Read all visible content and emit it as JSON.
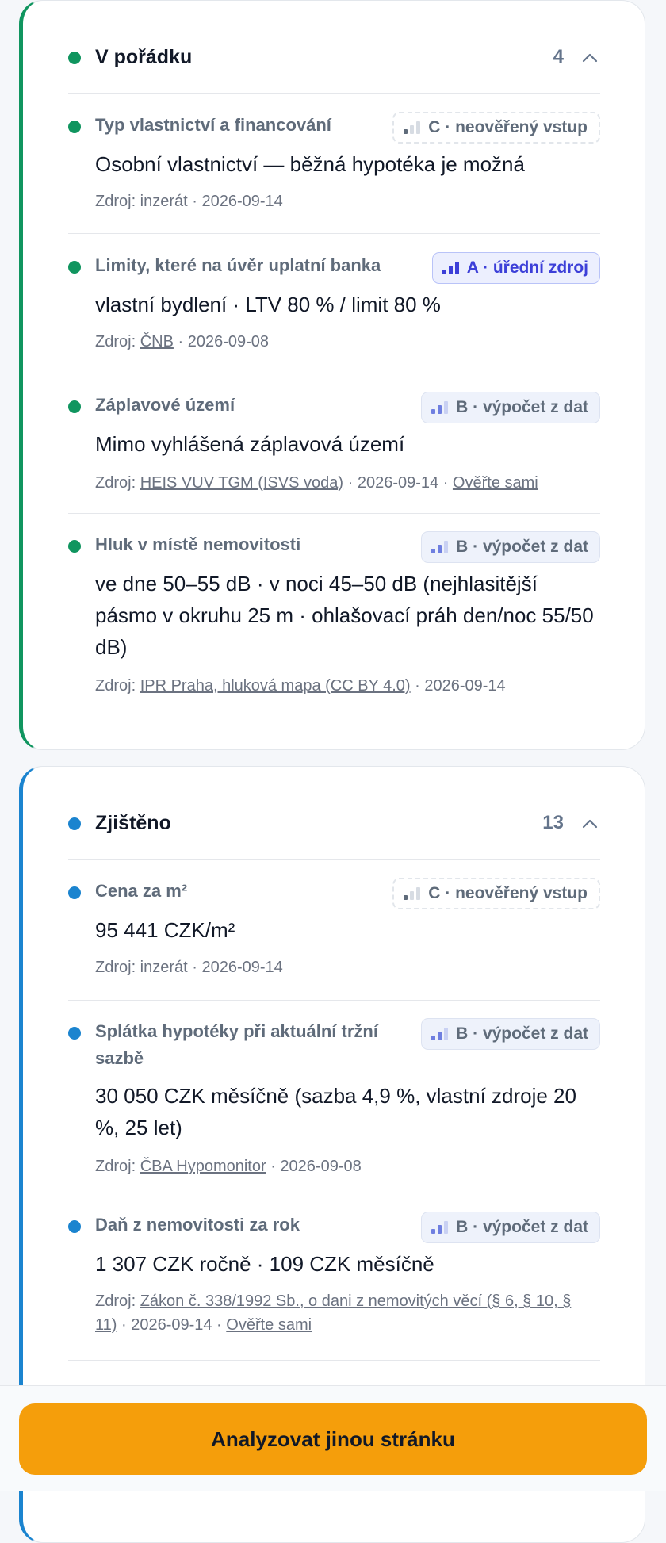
{
  "colors": {
    "ok": "#10955f",
    "found": "#1b84cf",
    "accent_button": "#f59e0b",
    "badge_a_text": "#3c3fd8",
    "muted_text": "#6b7280"
  },
  "sections": [
    {
      "title": "V pořádku",
      "count": "4",
      "chevron_icon": "chevron-up-icon",
      "items": [
        {
          "label": "Typ vlastnictví a financování",
          "badge": "C · neověřený vstup",
          "value": "Osobní vlastnictví — běžná hypotéka je možná",
          "source_prefix": "Zdroj: inzerát · 2026-09-14"
        },
        {
          "label": "Limity, které na úvěr uplatní banka",
          "badge": "A · úřední zdroj",
          "value": "vlastní bydlení · LTV 80 % / limit 80 %",
          "source_prefix": "Zdroj: ",
          "source_link": "ČNB",
          "source_suffix": " · 2026-09-08"
        },
        {
          "label": "Záplavové území",
          "badge": "B · výpočet z dat",
          "value": "Mimo vyhlášená záplavová území",
          "source_prefix": "Zdroj: ",
          "source_link": "HEIS VUV TGM (ISVS voda)",
          "source_suffix": " · 2026-09-14 · ",
          "verify_link": "Ověřte sami"
        },
        {
          "label": "Hluk v místě nemovitosti",
          "badge": "B · výpočet z dat",
          "value": "ve dne 50–55 dB · v noci 45–50 dB (nejhlasitější pásmo v okruhu 25 m · ohlašovací práh den/noc 55/50 dB)",
          "source_prefix": "Zdroj: ",
          "source_link": "IPR Praha, hluková mapa (CC BY 4.0)",
          "source_suffix": " · 2026-09-14"
        }
      ]
    },
    {
      "title": "Zjištěno",
      "count": "13",
      "chevron_icon": "chevron-up-icon",
      "items": [
        {
          "label": "Cena za m²",
          "badge": "C · neověřený vstup",
          "value": "95 441 CZK/m²",
          "source_prefix": "Zdroj: inzerát · 2026-09-14"
        },
        {
          "label": "Splátka hypotéky při aktuální tržní sazbě",
          "badge": "B · výpočet z dat",
          "value": "30 050 CZK měsíčně (sazba 4,9 %, vlastní zdroje 20 %, 25 let)",
          "source_prefix": "Zdroj: ",
          "source_link": "ČBA Hypomonitor",
          "source_suffix": " · 2026-09-08"
        },
        {
          "label": "Daň z nemovitosti za rok",
          "badge": "B · výpočet z dat",
          "value": "1 307 CZK ročně · 109 CZK měsíčně",
          "source_prefix": "Zdroj: ",
          "source_link": "Zákon č. 338/1992 Sb., o dani z nemovitých věcí (§ 6, § 10, § 11)",
          "source_suffix": " · 2026-09-14 · ",
          "verify_link": "Ověřte sami"
        }
      ]
    }
  ],
  "footer": {
    "cta_label": "Analyzovat jinou stránku"
  }
}
